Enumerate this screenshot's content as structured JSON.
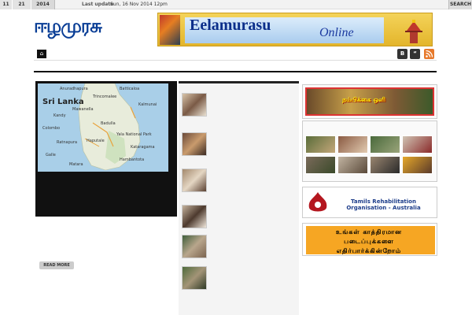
{
  "topbar": {
    "date_parts": [
      "11",
      "21",
      "2014"
    ],
    "last_update_label": "Last update",
    "last_update_value": "Sun, 16 Nov 2014 12pm",
    "ticker": "",
    "search_label": "SEARCH"
  },
  "header": {
    "logo_text": "ஈழமுரசு",
    "logo_sub": "",
    "banner_title": "Eelamurasu",
    "banner_online": "Online"
  },
  "nav": {
    "items": [
      "",
      "",
      "",
      "",
      "",
      "",
      ""
    ],
    "social": [
      "B",
      "“",
      "rss"
    ],
    "colors": {
      "rss": "#e7792b",
      "dark": "#333333"
    }
  },
  "featured": {
    "map_labels": [
      "Sri Lanka",
      "Anuradhapura",
      "Batticaloa",
      "Trincomalee",
      "Kandy",
      "Colombo",
      "Galle",
      "Matara",
      "Kataragama",
      "Hambantota",
      "Kalmunai",
      "Badulla",
      "Haputale",
      "Ratnapura",
      "Mawanella",
      "Yala National Park"
    ],
    "title": "",
    "body": "",
    "read_more": "READ MORE"
  },
  "news_list": [
    {
      "title": ""
    },
    {
      "title": ""
    },
    {
      "title": ""
    },
    {
      "title": ""
    },
    {
      "title": ""
    },
    {
      "title": ""
    }
  ],
  "sidebar": {
    "banner1_text": "நம்பிக்கை ஒளி",
    "gallery_title": "",
    "trao_tamil": "",
    "trao_name": "Tamils Rehabilitation Organisation - Australia",
    "trao_address": "",
    "ad_text": "உங்கள் காத்திரமான படைப்புக்களை எதிர்பார்க்கின்றோம்"
  }
}
